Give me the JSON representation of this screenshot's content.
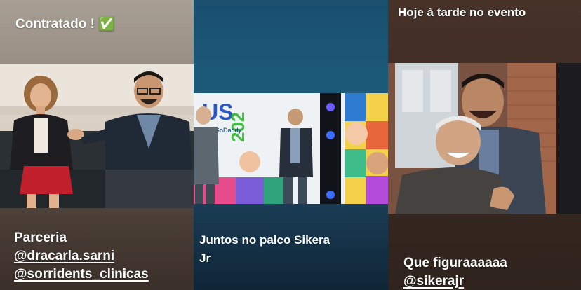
{
  "stories": [
    {
      "top_caption": "Contratado ! ✅",
      "bottom_caption": {
        "line1": "Parceria",
        "line2": "@dracarla.sarni",
        "line3": "@sorridents_clinicas"
      }
    },
    {
      "stage_text": {
        "event": "US",
        "year": "202",
        "brand": "GoDaddy"
      },
      "bottom_caption": {
        "line1": "Juntos no palco Sikera",
        "line2": "Jr"
      }
    },
    {
      "top_caption": "Hoje à tarde no evento",
      "bottom_caption": {
        "line1": "Que figuraaaaaa",
        "line2": "@sikerajr"
      }
    }
  ],
  "colors": {
    "caption": "#ffffff",
    "story1_bg": "#9a9085",
    "story2_bg": "#1d5a7a",
    "story3_bg": "#3a2a22"
  }
}
